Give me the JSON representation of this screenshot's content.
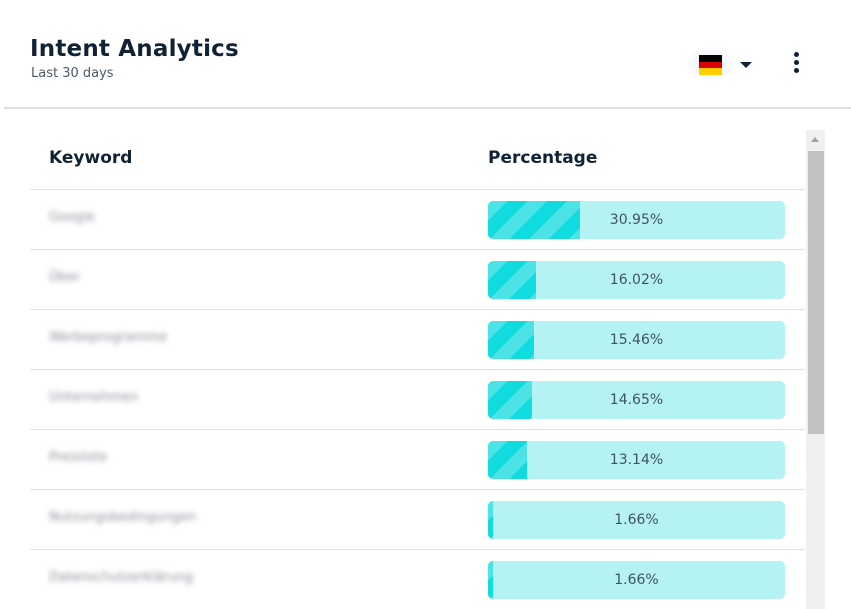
{
  "header": {
    "title": "Intent Analytics",
    "subtitle": "Last 30 days",
    "language": {
      "selected": "German",
      "icon": "germany-flag-icon",
      "flag_colors": [
        "#000000",
        "#dd0000",
        "#ffce00"
      ]
    },
    "more_icon": "more-vertical-icon"
  },
  "table": {
    "columns": [
      "Keyword",
      "Percentage"
    ],
    "rows": [
      {
        "keyword": "Google",
        "percentage": 30.95,
        "label": "30.95%"
      },
      {
        "keyword": "Über",
        "percentage": 16.02,
        "label": "16.02%"
      },
      {
        "keyword": "Werbeprogramme",
        "percentage": 15.46,
        "label": "15.46%"
      },
      {
        "keyword": "Unternehmen",
        "percentage": 14.65,
        "label": "14.65%"
      },
      {
        "keyword": "Preisliste",
        "percentage": 13.14,
        "label": "13.14%"
      },
      {
        "keyword": "Nutzungsbedingungen",
        "percentage": 1.66,
        "label": "1.66%"
      },
      {
        "keyword": "Datenschutzerklärung",
        "percentage": 1.66,
        "label": "1.66%"
      }
    ]
  },
  "colors": {
    "bar_track": "#b5f2f3",
    "bar_fill_light": "#4be3e6",
    "bar_fill_dark": "#10dcdf",
    "text_dark": "#102235"
  }
}
